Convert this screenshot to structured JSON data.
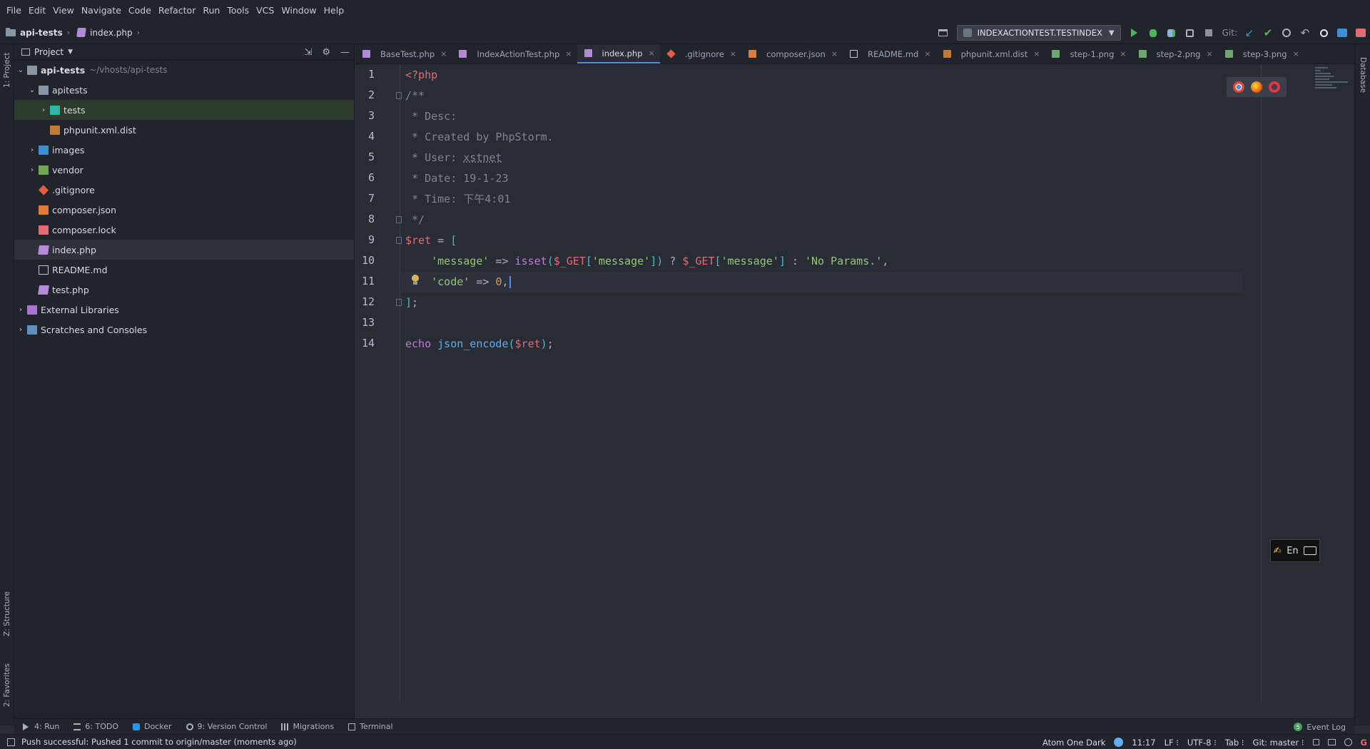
{
  "menu": [
    "File",
    "Edit",
    "View",
    "Navigate",
    "Code",
    "Refactor",
    "Run",
    "Tools",
    "VCS",
    "Window",
    "Help"
  ],
  "breadcrumb": {
    "project": "api-tests",
    "file": "index.php"
  },
  "toolbar": {
    "run_config": "INDEXACTIONTEST.TESTINDEX",
    "git_label": "Git:"
  },
  "left_strip": {
    "project_tab": "1: Project",
    "structure_tab": "Z: Structure",
    "favorites_tab": "2: Favorites"
  },
  "right_strip": {
    "database_tab": "Database"
  },
  "project_panel": {
    "title": "Project",
    "tree": [
      {
        "label": "api-tests",
        "hint": "~/vhosts/api-tests",
        "indent": 0,
        "arrow": "expanded",
        "icon": "folder"
      },
      {
        "label": "apitests",
        "hint": "",
        "indent": 1,
        "arrow": "expanded",
        "icon": "folder"
      },
      {
        "label": "tests",
        "hint": "",
        "indent": 2,
        "arrow": "collapsed",
        "icon": "folder-teal"
      },
      {
        "label": "phpunit.xml.dist",
        "hint": "",
        "indent": 2,
        "arrow": "none",
        "icon": "xml"
      },
      {
        "label": "images",
        "hint": "",
        "indent": 1,
        "arrow": "collapsed",
        "icon": "folder-img"
      },
      {
        "label": "vendor",
        "hint": "",
        "indent": 1,
        "arrow": "collapsed",
        "icon": "folder-green"
      },
      {
        "label": ".gitignore",
        "hint": "",
        "indent": 1,
        "arrow": "none",
        "icon": "git"
      },
      {
        "label": "composer.json",
        "hint": "",
        "indent": 1,
        "arrow": "none",
        "icon": "composer"
      },
      {
        "label": "composer.lock",
        "hint": "",
        "indent": 1,
        "arrow": "none",
        "icon": "lock"
      },
      {
        "label": "index.php",
        "hint": "",
        "indent": 1,
        "arrow": "none",
        "icon": "php"
      },
      {
        "label": "README.md",
        "hint": "",
        "indent": 1,
        "arrow": "none",
        "icon": "md"
      },
      {
        "label": "test.php",
        "hint": "",
        "indent": 1,
        "arrow": "none",
        "icon": "php"
      },
      {
        "label": "External Libraries",
        "hint": "",
        "indent": 0,
        "arrow": "collapsed",
        "icon": "lib"
      },
      {
        "label": "Scratches and Consoles",
        "hint": "",
        "indent": 0,
        "arrow": "collapsed",
        "icon": "scratch"
      }
    ]
  },
  "tabs": [
    {
      "label": "BaseTest.php",
      "icon": "php",
      "active": false
    },
    {
      "label": "IndexActionTest.php",
      "icon": "php",
      "active": false
    },
    {
      "label": "index.php",
      "icon": "php",
      "active": true
    },
    {
      "label": ".gitignore",
      "icon": "git",
      "active": false
    },
    {
      "label": "composer.json",
      "icon": "comp",
      "active": false
    },
    {
      "label": "README.md",
      "icon": "md",
      "active": false
    },
    {
      "label": "phpunit.xml.dist",
      "icon": "xml",
      "active": false
    },
    {
      "label": "step-1.png",
      "icon": "png",
      "active": false
    },
    {
      "label": "step-2.png",
      "icon": "png",
      "active": false
    },
    {
      "label": "step-3.png",
      "icon": "png",
      "active": false
    }
  ],
  "code_lines": [
    [
      [
        "tag",
        "<?php"
      ]
    ],
    [
      [
        "com",
        "/**"
      ]
    ],
    [
      [
        "com",
        " * Desc:"
      ]
    ],
    [
      [
        "com",
        " * Created by PhpStorm."
      ]
    ],
    [
      [
        "com",
        " * User: "
      ],
      [
        "com-u",
        "xstnet"
      ]
    ],
    [
      [
        "com",
        " * Date: 19-1-23"
      ]
    ],
    [
      [
        "com",
        " * Time: 下午4:01"
      ]
    ],
    [
      [
        "com",
        " */"
      ]
    ],
    [
      [
        "var",
        "$ret"
      ],
      [
        "",
        " = "
      ],
      [
        "op",
        "["
      ]
    ],
    [
      [
        "",
        "    "
      ],
      [
        "str",
        "'message'"
      ],
      [
        "",
        " => "
      ],
      [
        "kw",
        "isset"
      ],
      [
        "op",
        "("
      ],
      [
        "var",
        "$_GET"
      ],
      [
        "op",
        "["
      ],
      [
        "str",
        "'message'"
      ],
      [
        "op",
        "])"
      ],
      [
        "",
        " ? "
      ],
      [
        "var",
        "$_GET"
      ],
      [
        "op",
        "["
      ],
      [
        "str",
        "'message'"
      ],
      [
        "op",
        "]"
      ],
      [
        "",
        " : "
      ],
      [
        "str",
        "'No Params.'"
      ],
      [
        "",
        ","
      ]
    ],
    [
      [
        "",
        "    "
      ],
      [
        "str",
        "'code'"
      ],
      [
        "",
        " => "
      ],
      [
        "num",
        "0"
      ],
      [
        "",
        ","
      ],
      [
        "cursor",
        ""
      ]
    ],
    [
      [
        "op",
        "]"
      ],
      [
        "",
        ";"
      ]
    ],
    [],
    [
      [
        "kw",
        "echo"
      ],
      [
        "",
        " "
      ],
      [
        "fn",
        "json_encode"
      ],
      [
        "op",
        "("
      ],
      [
        "var",
        "$ret"
      ],
      [
        "op",
        ")"
      ],
      [
        "",
        ";"
      ]
    ]
  ],
  "ime": {
    "label": "En"
  },
  "bottom_tools": [
    {
      "label": "4: Run",
      "icon": "run"
    },
    {
      "label": "6: TODO",
      "icon": "list"
    },
    {
      "label": "Docker",
      "icon": "docker"
    },
    {
      "label": "9: Version Control",
      "icon": "vcs"
    },
    {
      "label": "Migrations",
      "icon": "mig"
    },
    {
      "label": "Terminal",
      "icon": "term"
    }
  ],
  "event_log": "Event Log",
  "status": {
    "message": "Push successful: Pushed 1 commit to origin/master (moments ago)",
    "theme": "Atom One Dark",
    "position": "11:17",
    "line_sep": "LF ⁝",
    "encoding": "UTF-8 ⁝",
    "indent": "Tab ⁝",
    "git_branch": "Git: master ⁝"
  }
}
